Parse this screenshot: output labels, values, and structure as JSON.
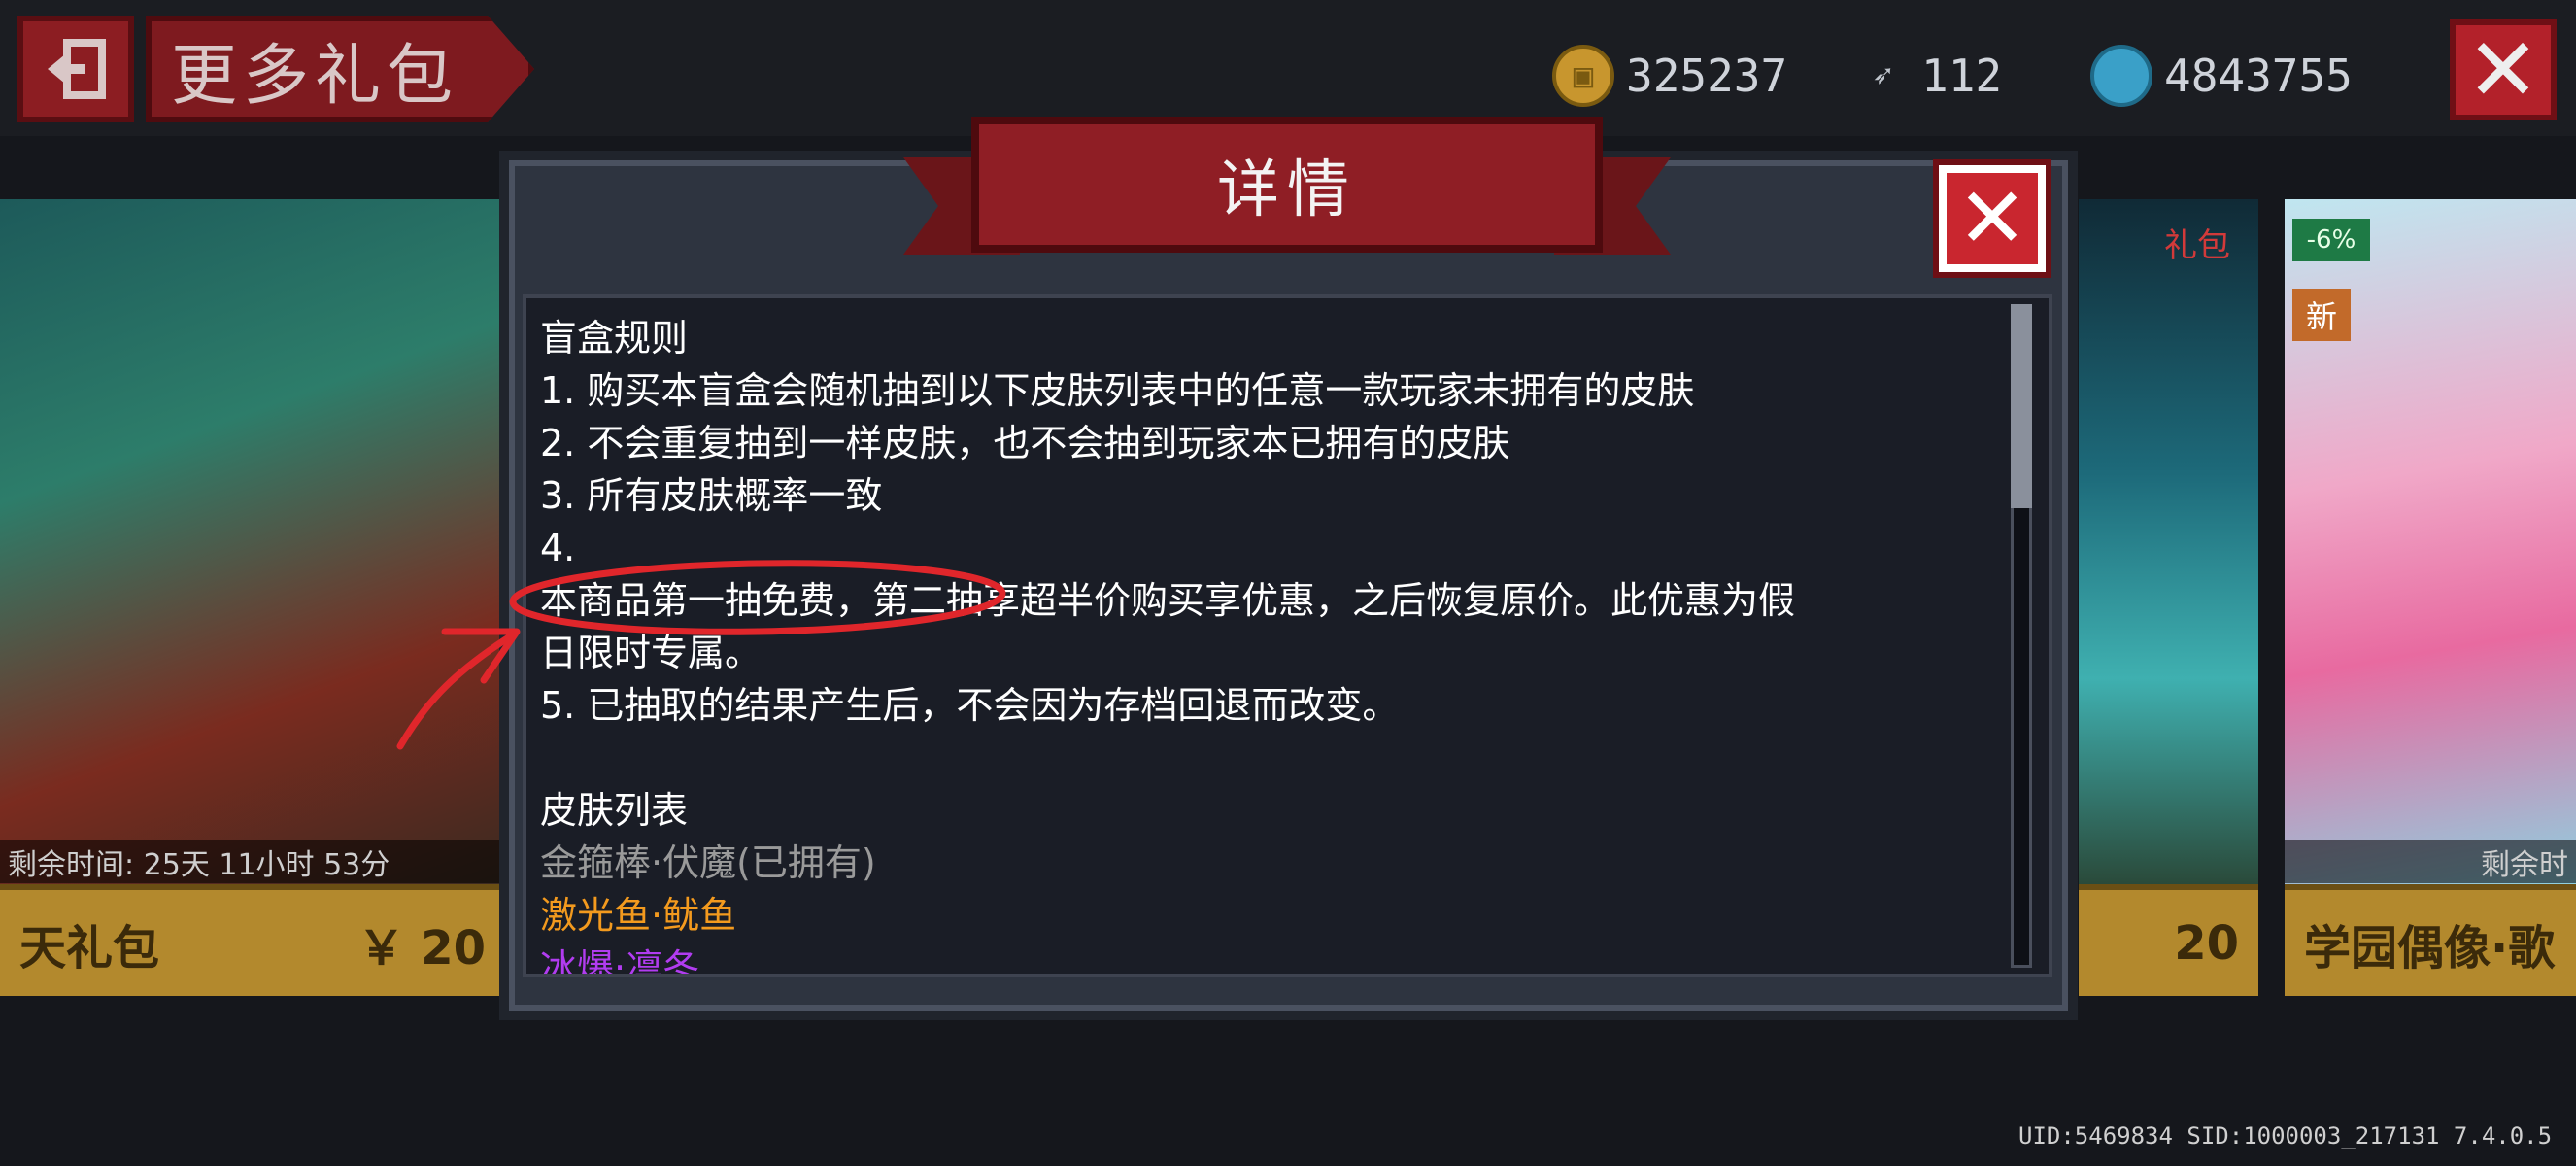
{
  "header": {
    "title": "更多礼包",
    "currencies": [
      {
        "icon": "gold-coin-icon",
        "value": "325237"
      },
      {
        "icon": "fish-icon",
        "value": "112"
      },
      {
        "icon": "gem-icon",
        "value": "4843755"
      }
    ]
  },
  "cards": {
    "left": {
      "timer": "剩余时间: 25天 11小时 53分",
      "name": "天礼包",
      "price": "￥ 20"
    },
    "right_mid": {
      "tag": "礼包",
      "price": "20"
    },
    "right": {
      "discount": "-6%",
      "new_badge": "新",
      "timer": "剩余时",
      "name": "学园偶像·歌"
    }
  },
  "dialog": {
    "title": "详情",
    "lines": [
      "盲盒规则",
      "1. 购买本盲盒会随机抽到以下皮肤列表中的任意一款玩家未拥有的皮肤",
      "2. 不会重复抽到一样皮肤，也不会抽到玩家本已拥有的皮肤",
      "3. 所有皮肤概率一致",
      "4.",
      "本商品第一抽免费，第二抽享超半价购买享优惠，之后恢复原价。此优惠为假",
      "日限时专属。",
      "5. 已抽取的结果产生后，不会因为存档回退而改变。",
      "",
      "皮肤列表"
    ],
    "skins": [
      "金箍棒·伏魔(已拥有)",
      "激光鱼·鱿鱼",
      "冰爆·凛冬"
    ]
  },
  "footer": {
    "uid": "UID:5469834 SID:1000003_217131 7.4.0.5"
  },
  "colors": {
    "accent_red": "#8f1e25",
    "owned_gray": "#9a9a9a",
    "orange_rarity": "#f39a1e",
    "purple_rarity": "#b13cf0",
    "annotation_red": "#e0262b"
  }
}
